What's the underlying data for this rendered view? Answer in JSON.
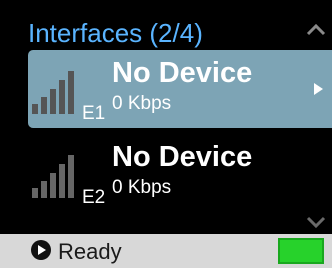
{
  "header": {
    "title": "Interfaces (2/4)",
    "scroll_up_icon": "chevron-up-icon"
  },
  "interfaces": [
    {
      "title": "No Device",
      "rate": "0 Kbps",
      "code": "E1",
      "selected": true,
      "signal_icon": "signal-bars-icon",
      "arrow_icon": "triangle-right-icon"
    },
    {
      "title": "No Device",
      "rate": "0 Kbps",
      "code": "E2",
      "selected": false,
      "signal_icon": "signal-bars-icon"
    }
  ],
  "footer": {
    "scroll_down_icon": "chevron-down-icon",
    "status_icon": "play-circle-icon",
    "status_text": "Ready",
    "battery_icon": "battery-icon"
  },
  "colors": {
    "title": "#5ab4ff",
    "selected_row": "#7da4b5",
    "status_bar": "#d8d8d8",
    "battery": "#27d22b"
  }
}
